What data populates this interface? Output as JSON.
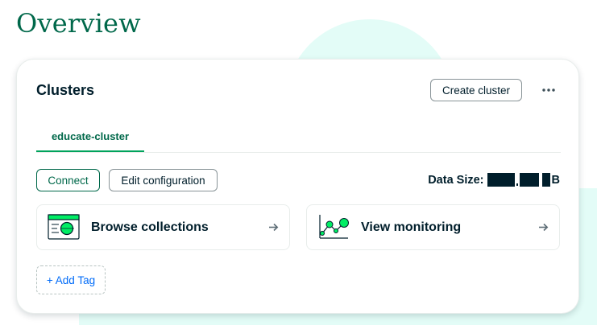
{
  "page": {
    "title": "Overview"
  },
  "clusters": {
    "heading": "Clusters",
    "create_label": "Create cluster",
    "more_icon": "ellipsis-icon",
    "tab_label": "educate-cluster",
    "connect_label": "Connect",
    "edit_label": "Edit configuration",
    "data_size_label": "Data Size:",
    "data_size_suffix": "B",
    "tiles": [
      {
        "label": "Browse collections",
        "icon": "collection-browser-icon"
      },
      {
        "label": "View monitoring",
        "icon": "monitoring-chart-icon"
      }
    ],
    "add_tag_label": "+ Add Tag"
  },
  "colors": {
    "brand_green": "#00684a",
    "accent_green": "#00a35c",
    "mint_background": "#e3fcf7",
    "link_blue": "#016bf8",
    "text_dark": "#001e2b"
  }
}
